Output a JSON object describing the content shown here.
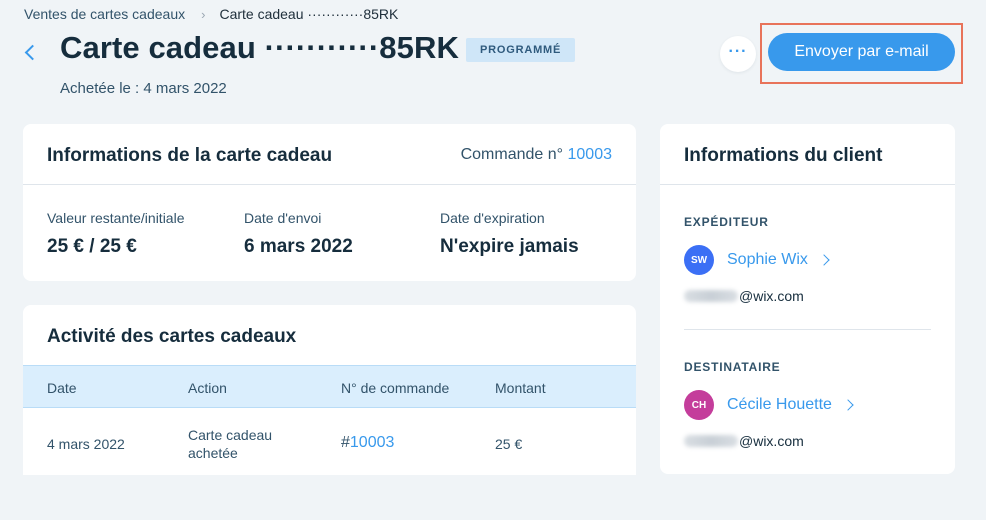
{
  "breadcrumb": {
    "items": [
      "Ventes de cartes cadeaux",
      "Carte cadeau ············85RK"
    ],
    "separator": "›"
  },
  "header": {
    "title": "Carte cadeau ···········85RK",
    "status_badge": "PROGRAMMÉ",
    "purchased_label": "Achetée le : 4 mars 2022",
    "more_label": "···",
    "send_email_label": "Envoyer par e-mail"
  },
  "gift_card_info": {
    "title": "Informations de la carte cadeau",
    "order_label": "Commande n°",
    "order_number": "10003",
    "fields": [
      {
        "label": "Valeur restante/initiale",
        "value": "25 € / 25 €"
      },
      {
        "label": "Date d'envoi",
        "value": "6 mars 2022"
      },
      {
        "label": "Date d'expiration",
        "value": "N'expire jamais"
      }
    ]
  },
  "activity": {
    "title": "Activité des cartes cadeaux",
    "columns": [
      "Date",
      "Action",
      "N° de commande",
      "Montant"
    ],
    "rows": [
      {
        "date": "4 mars 2022",
        "action": "Carte cadeau achetée",
        "order_prefix": "#",
        "order_number": "10003",
        "amount": "25 €"
      }
    ]
  },
  "client_info": {
    "title": "Informations du client",
    "sender": {
      "section_label": "EXPÉDITEUR",
      "initials": "SW",
      "avatar_color": "#3b6ff5",
      "name": "Sophie Wix",
      "email_domain": "@wix.com"
    },
    "recipient": {
      "section_label": "DESTINATAIRE",
      "initials": "CH",
      "avatar_color": "#c43d9b",
      "name": "Cécile Houette",
      "email_domain": "@wix.com"
    }
  },
  "colors": {
    "accent": "#3899ec",
    "background": "#f0f4f7",
    "badge_bg": "#cfe6f8",
    "highlight_frame": "#e8735a"
  }
}
